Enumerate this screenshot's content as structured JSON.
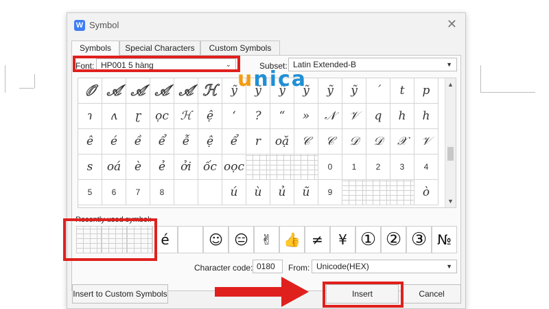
{
  "window": {
    "title": "Symbol",
    "close_glyph": "✕",
    "app_icon_letter": "W"
  },
  "tabs": [
    "Symbols",
    "Special Characters",
    "Custom Symbols"
  ],
  "font": {
    "label": "Font:",
    "value": "HP001 5 hàng"
  },
  "subset": {
    "label": "Subset:",
    "value": "Latin Extended-B"
  },
  "grid": {
    "rows": [
      [
        "𝒪",
        "𝒜",
        "𝒜",
        "𝒜",
        "𝒜",
        "ℋ",
        "ỹ",
        "ỹ",
        "ỹ",
        "ỹ",
        "ỹ",
        "ỹ",
        "´",
        "t",
        "p"
      ],
      [
        "ɿ",
        "ʌ",
        "ɽ",
        "ọc",
        "ℋ",
        "ệ",
        "‘",
        "?",
        "“",
        "»",
        "𝒩",
        "𝒱",
        "q",
        "h",
        "h"
      ],
      [
        "ê",
        "é",
        "ề",
        "ể",
        "ễ",
        "ệ",
        "ể",
        "r",
        "oặ",
        "𝒞",
        "𝒞",
        "𝒟",
        "𝒟",
        "𝒳",
        "𝒱"
      ],
      [
        "s",
        "oá",
        "è",
        "ẻ",
        "ởi",
        "ốc",
        "oọc",
        "",
        "",
        "",
        "0",
        "1",
        "2",
        "3",
        "4"
      ],
      [
        "5",
        "6",
        "7",
        "8",
        "",
        "",
        "ú",
        "ù",
        "ủ",
        "ũ",
        "9",
        "",
        "",
        "",
        "ò"
      ]
    ],
    "hollow": [
      [
        0,
        0
      ],
      [
        0,
        1
      ],
      [
        0,
        2
      ],
      [
        0,
        3
      ],
      [
        0,
        4
      ],
      [
        0,
        5
      ]
    ],
    "lined": [
      [
        3,
        7
      ],
      [
        3,
        8
      ],
      [
        3,
        9
      ],
      [
        4,
        11
      ],
      [
        4,
        12
      ],
      [
        4,
        13
      ]
    ]
  },
  "recent": {
    "label": "Recently used symbol:",
    "items": [
      "",
      "",
      "",
      "é",
      "",
      "☺",
      "😑",
      "✌",
      "👍",
      "≠",
      "¥",
      "①",
      "②",
      "③",
      "№"
    ]
  },
  "character_code": {
    "label": "Character code:",
    "value": "0180"
  },
  "from": {
    "label": "From:",
    "value": "Unicode(HEX)"
  },
  "buttons": {
    "insert_custom": "Insert to Custom Symbols",
    "insert": "Insert",
    "cancel": "Cancel"
  },
  "watermark": {
    "first": "u",
    "rest": "nica"
  },
  "colors": {
    "highlight": "#e0201d",
    "brand_orange": "#f39c12",
    "brand_blue": "#1f8fd6",
    "dialog_bg": "#f2f2f2"
  }
}
